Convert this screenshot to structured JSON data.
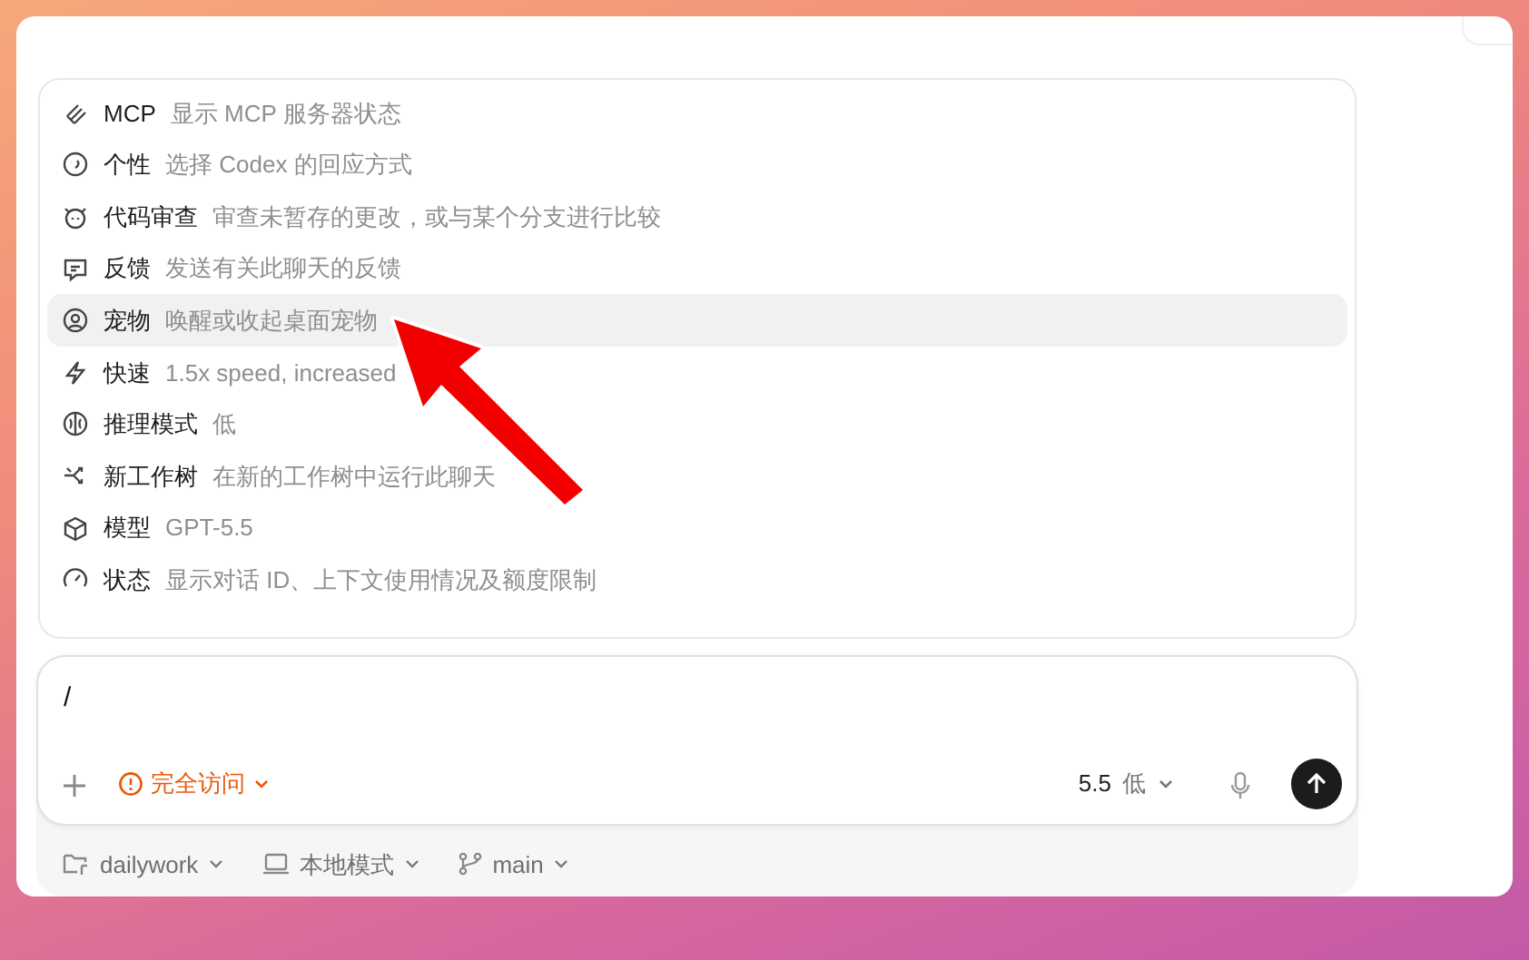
{
  "command_menu": {
    "items": [
      {
        "name": "MCP",
        "description": "显示 MCP 服务器状态",
        "selected": false
      },
      {
        "name": "个性",
        "description": "选择 Codex 的回应方式",
        "selected": false
      },
      {
        "name": "代码审查",
        "description": "审查未暂存的更改，或与某个分支进行比较",
        "selected": false
      },
      {
        "name": "反馈",
        "description": "发送有关此聊天的反馈",
        "selected": false
      },
      {
        "name": "宠物",
        "description": "唤醒或收起桌面宠物",
        "selected": true
      },
      {
        "name": "快速",
        "description": "1.5x speed, increased",
        "selected": false
      },
      {
        "name": "推理模式",
        "description": "低",
        "selected": false
      },
      {
        "name": "新工作树",
        "description": "在新的工作树中运行此聊天",
        "selected": false
      },
      {
        "name": "模型",
        "description": "GPT-5.5",
        "selected": false
      },
      {
        "name": "状态",
        "description": "显示对话 ID、上下文使用情况及额度限制",
        "selected": false
      }
    ]
  },
  "composer": {
    "value": "/",
    "access": "完全访问",
    "model": "5.5",
    "reasoning": "低"
  },
  "footer": {
    "project": "dailywork",
    "mode": "本地模式",
    "branch": "main"
  }
}
